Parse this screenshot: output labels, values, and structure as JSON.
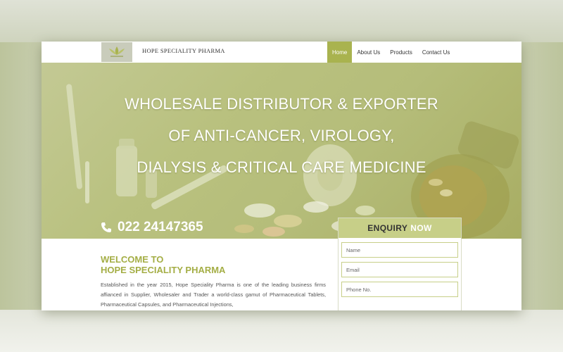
{
  "header": {
    "brand": "HOPE SPECIALITY PHARMA",
    "nav": [
      {
        "label": "Home",
        "active": true
      },
      {
        "label": "About Us",
        "active": false
      },
      {
        "label": "Products",
        "active": false
      },
      {
        "label": "Contact Us",
        "active": false
      }
    ]
  },
  "hero": {
    "lines": [
      "WHOLESALE DISTRIBUTOR & EXPORTER",
      "OF ANTI-CANCER, VIROLOGY,",
      "DIALYSIS & CRITICAL CARE MEDICINE"
    ],
    "phone": "022 24147365",
    "phone_icon": "phone-icon"
  },
  "welcome": {
    "title_line1": "WELCOME TO",
    "title_line2": "HOPE SPECIALITY PHARMA",
    "body": "Established in the year 2015, Hope Speciality Pharma is one of the leading business firms affianced in Supplier, Wholesaler and Trader a world-class gamut of Pharmaceutical Tablets, Pharmaceutical Capsules, and Pharmaceutical Injections,"
  },
  "enquiry": {
    "title": "ENQUIRY",
    "title_accent": "NOW",
    "fields": [
      {
        "placeholder": "Name"
      },
      {
        "placeholder": "Email"
      },
      {
        "placeholder": "Phone No."
      }
    ]
  },
  "colors": {
    "accent": "#a9b34f",
    "title_green": "#a4ae45",
    "enquiry_header": "#c7cf88"
  }
}
